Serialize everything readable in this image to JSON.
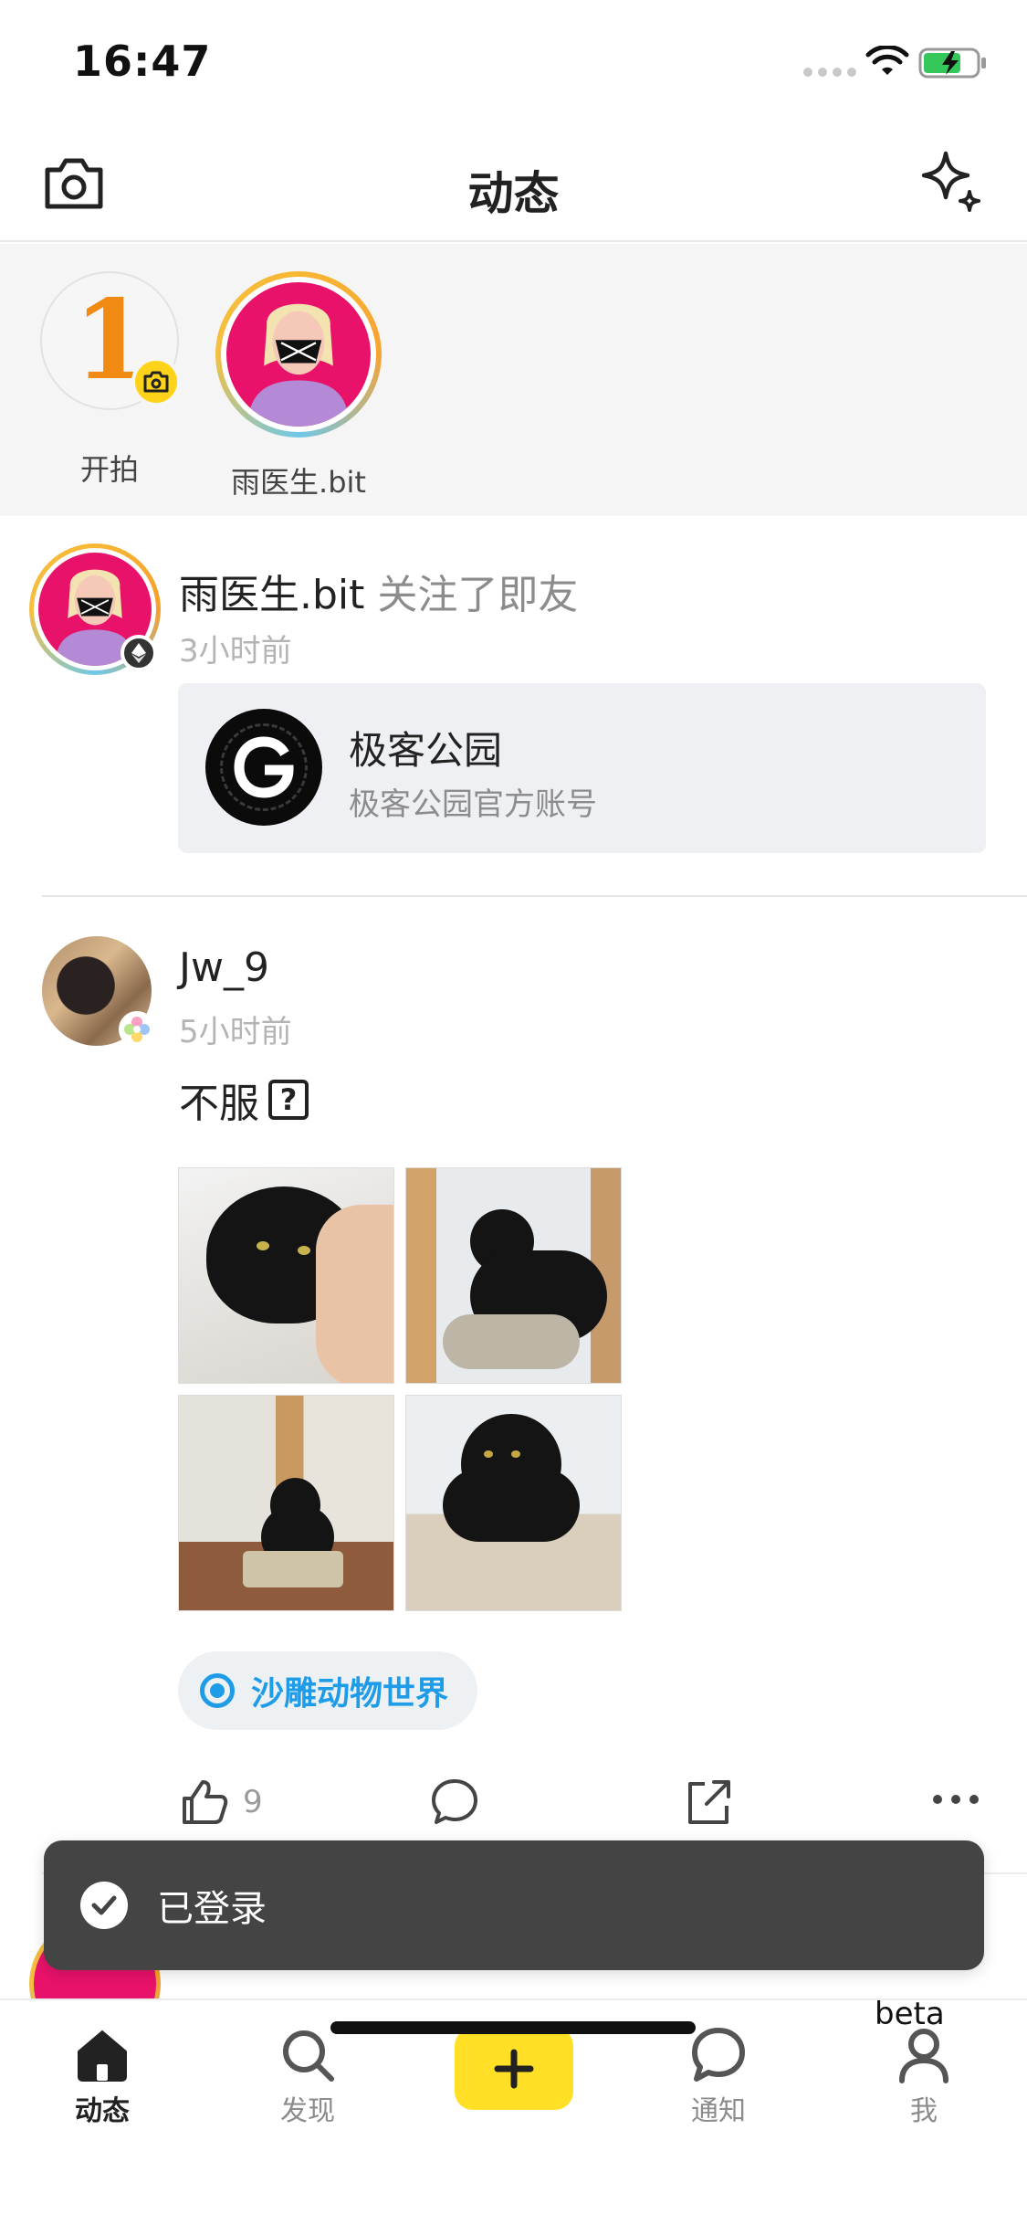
{
  "status_bar": {
    "time": "16:47"
  },
  "nav": {
    "title": "动态",
    "left_icon": "camera-icon",
    "right_icon": "sparkle-icon"
  },
  "stories": [
    {
      "label": "开拍",
      "badge_number": "1",
      "badge_icon": "camera-icon"
    },
    {
      "label": "雨医生.bit"
    }
  ],
  "feed": {
    "item1": {
      "user": "雨医生.bit",
      "action": "关注了即友",
      "time": "3小时前",
      "card": {
        "title": "极客公园",
        "subtitle": "极客公园官方账号"
      }
    },
    "item2": {
      "user": "Jw_9",
      "time": "5小时前",
      "text": "不服",
      "emoji_box": "?",
      "image_count": 4,
      "topic": "沙雕动物世界",
      "likes": "9"
    }
  },
  "toast": {
    "text": "已登录",
    "icon": "check-icon"
  },
  "tab_bar": {
    "tabs": [
      {
        "label": "动态",
        "icon": "home-icon"
      },
      {
        "label": "发现",
        "icon": "search-icon"
      },
      {
        "label": "通知",
        "icon": "chat-bubble-icon"
      },
      {
        "label": "我",
        "icon": "person-icon"
      }
    ],
    "post_icon": "plus-icon",
    "beta": "beta"
  },
  "colors": {
    "accent_yellow": "#FFE027",
    "topic_blue": "#1E9CE8",
    "toast_bg": "#454444"
  }
}
